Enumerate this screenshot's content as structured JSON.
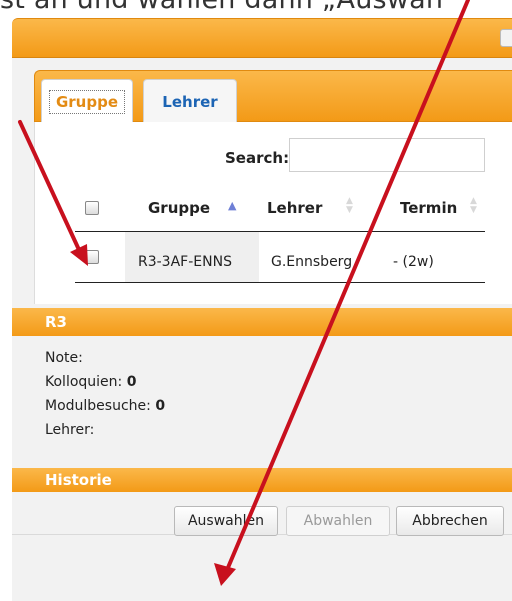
{
  "instruction": "st an und wählen dann „Auswäh",
  "tabs": [
    {
      "label": "Gruppe",
      "active": true
    },
    {
      "label": "Lehrer",
      "active": false
    }
  ],
  "search": {
    "label": "Search:",
    "value": ""
  },
  "table": {
    "columns": [
      "Gruppe",
      "Lehrer",
      "Termin"
    ],
    "sorted_column": "Gruppe",
    "rows": [
      {
        "checked": false,
        "gruppe": "R3-3AF-ENNS",
        "lehrer": "G.Ennsberg",
        "termin": "- (2w)"
      }
    ]
  },
  "details": {
    "header": "R3",
    "note_label": "Note:",
    "kolloquien_label": "Kolloquien:",
    "kolloquien_value": "0",
    "modulbesuche_label": "Modulbesuche:",
    "modulbesuche_value": "0",
    "lehrer_label": "Lehrer:"
  },
  "historie": {
    "header": "Historie"
  },
  "buttons": {
    "select": "Auswahlen",
    "deselect": "Abwahlen",
    "cancel": "Abbrechen"
  },
  "colors": {
    "accent_orange": "#f39a17",
    "tab_link_blue": "#1c64b4",
    "annotation_red": "#c8101e"
  },
  "icons": [
    "sort-ascending-icon",
    "sort-both-icon",
    "annotation-arrow-icon"
  ]
}
